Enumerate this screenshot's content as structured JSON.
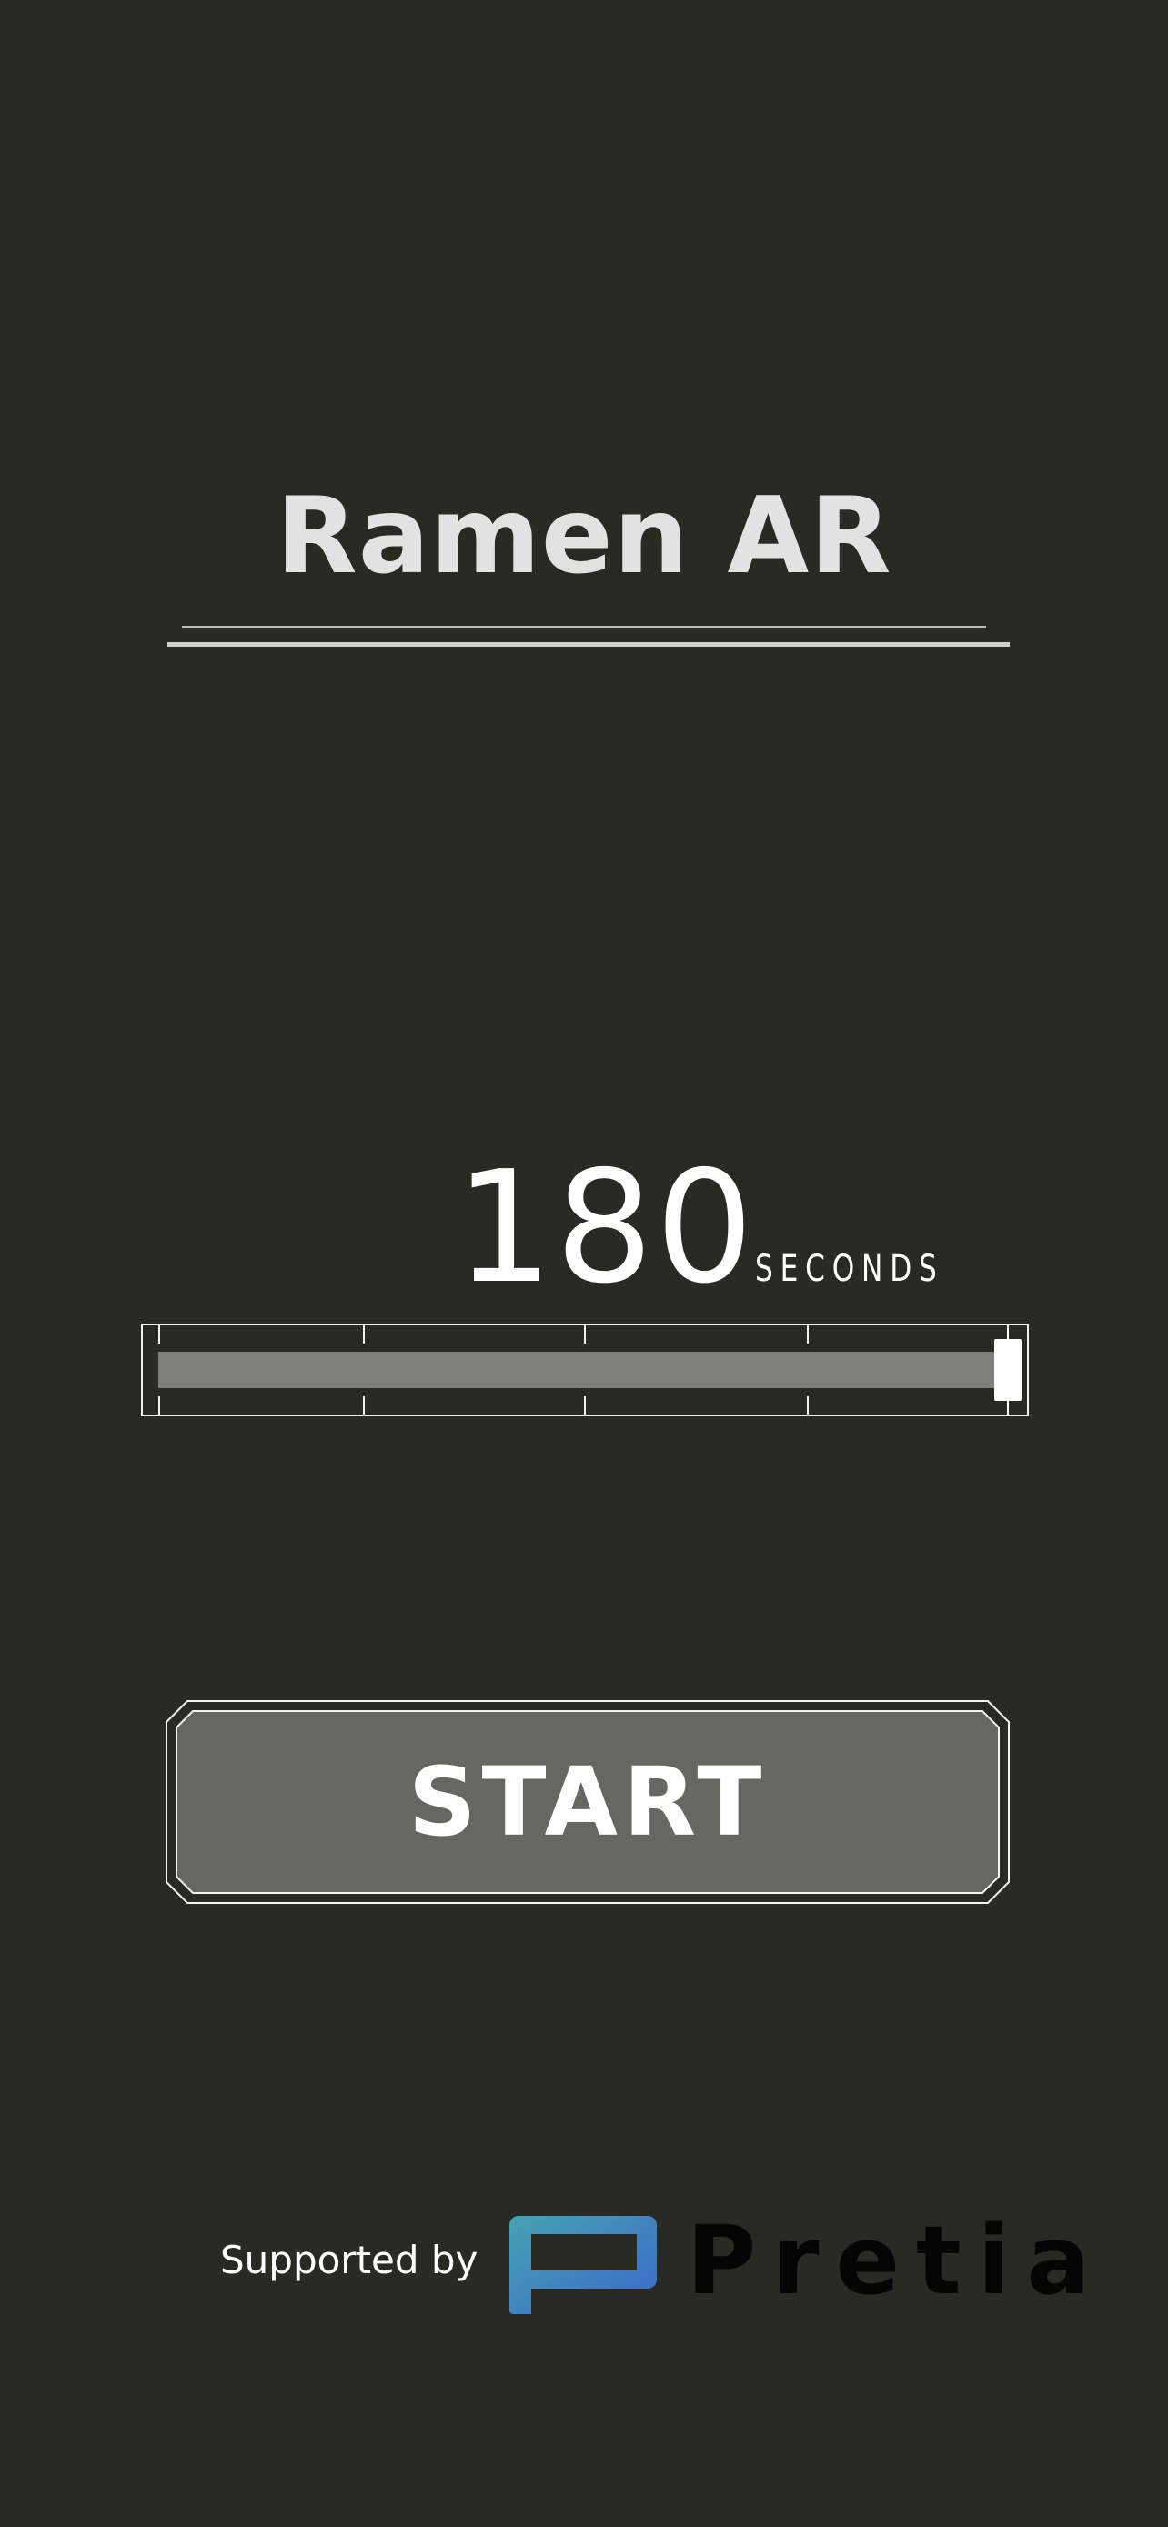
{
  "app": {
    "title": "Ramen AR"
  },
  "timer": {
    "value": "180",
    "unit_label": "SECONDS",
    "slider_level": 1.0
  },
  "actions": {
    "start_label": "START"
  },
  "footer": {
    "supported_label": "Supported by",
    "logo_text": "Pretia",
    "logo_icon": "pretia-logo-icon"
  },
  "colors": {
    "background": "#2a2a24",
    "button_fill": "#676762",
    "track_fill": "#7f7f7b",
    "logo_gradient_start": "#45a3b3",
    "logo_gradient_end": "#3b67c9"
  }
}
